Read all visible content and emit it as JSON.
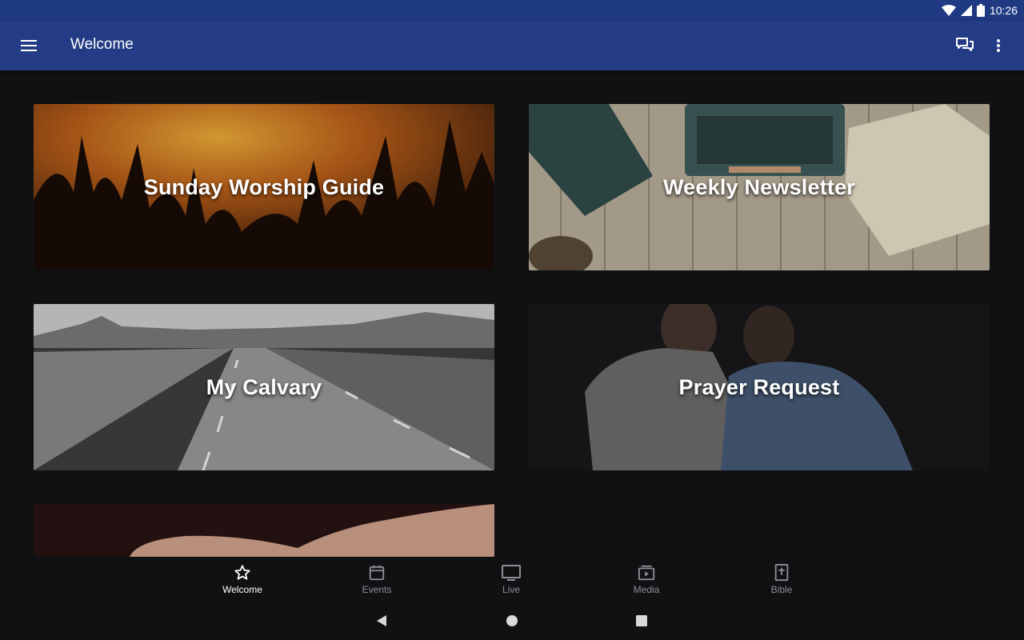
{
  "status_bar": {
    "time": "10:26"
  },
  "app_bar": {
    "title": "Welcome",
    "menu_icon": "hamburger-icon",
    "chat_icon": "chat-icon",
    "more_icon": "more-vert-icon"
  },
  "tiles": [
    {
      "label": "Sunday Worship Guide"
    },
    {
      "label": "Weekly Newsletter"
    },
    {
      "label": "My Calvary"
    },
    {
      "label": "Prayer Request"
    }
  ],
  "bottom_nav": {
    "items": [
      {
        "label": "Welcome",
        "icon": "star-icon",
        "active": true
      },
      {
        "label": "Events",
        "icon": "calendar-icon",
        "active": false
      },
      {
        "label": "Live",
        "icon": "tv-icon",
        "active": false
      },
      {
        "label": "Media",
        "icon": "media-icon",
        "active": false
      },
      {
        "label": "Bible",
        "icon": "bible-icon",
        "active": false
      }
    ]
  },
  "colors": {
    "app_bar": "#233c85",
    "background": "#101113",
    "active_nav": "#ffffff",
    "inactive_nav": "#8e9095"
  }
}
